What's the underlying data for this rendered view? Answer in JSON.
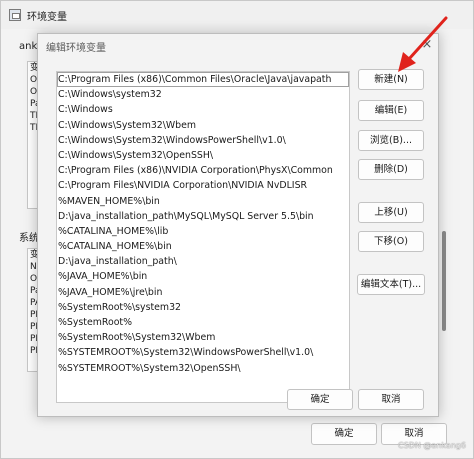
{
  "background_window": {
    "title": "环境变量",
    "user_section_label": "ank",
    "user_list_items": [
      "变",
      "On",
      "On",
      "Pa",
      "TE",
      "TM"
    ],
    "system_section_label": "系统",
    "system_list_items": [
      "变",
      "NU",
      "OS",
      "Pa",
      "PA",
      "PR",
      "PR",
      "PR",
      "PR"
    ],
    "ok_label": "确定",
    "cancel_label": "取消"
  },
  "dialog": {
    "title": "编辑环境变量",
    "close_glyph": "×",
    "paths": [
      "C:\\Program Files (x86)\\Common Files\\Oracle\\Java\\javapath",
      "C:\\Windows\\system32",
      "C:\\Windows",
      "C:\\Windows\\System32\\Wbem",
      "C:\\Windows\\System32\\WindowsPowerShell\\v1.0\\",
      "C:\\Windows\\System32\\OpenSSH\\",
      "C:\\Program Files (x86)\\NVIDIA Corporation\\PhysX\\Common",
      "C:\\Program Files\\NVIDIA Corporation\\NVIDIA NvDLISR",
      "%MAVEN_HOME%\\bin",
      "D:\\java_installation_path\\MySQL\\MySQL Server 5.5\\bin",
      "%CATALINA_HOME%\\lib",
      "%CATALINA_HOME%\\bin",
      "D:\\java_installation_path\\",
      "%JAVA_HOME%\\bin",
      "%JAVA_HOME%\\jre\\bin",
      "%SystemRoot%\\system32",
      "%SystemRoot%",
      "%SystemRoot%\\System32\\Wbem",
      "%SYSTEMROOT%\\System32\\WindowsPowerShell\\v1.0\\",
      "%SYSTEMROOT%\\System32\\OpenSSH\\"
    ],
    "buttons": {
      "new": "新建(N)",
      "edit": "编辑(E)",
      "browse": "浏览(B)...",
      "delete": "删除(D)",
      "move_up": "上移(U)",
      "move_down": "下移(O)",
      "edit_text": "编辑文本(T)...",
      "ok": "确定",
      "cancel": "取消"
    }
  },
  "annotation": {
    "arrow_color": "#e0231c"
  },
  "watermark": "CSDN @ankang6"
}
